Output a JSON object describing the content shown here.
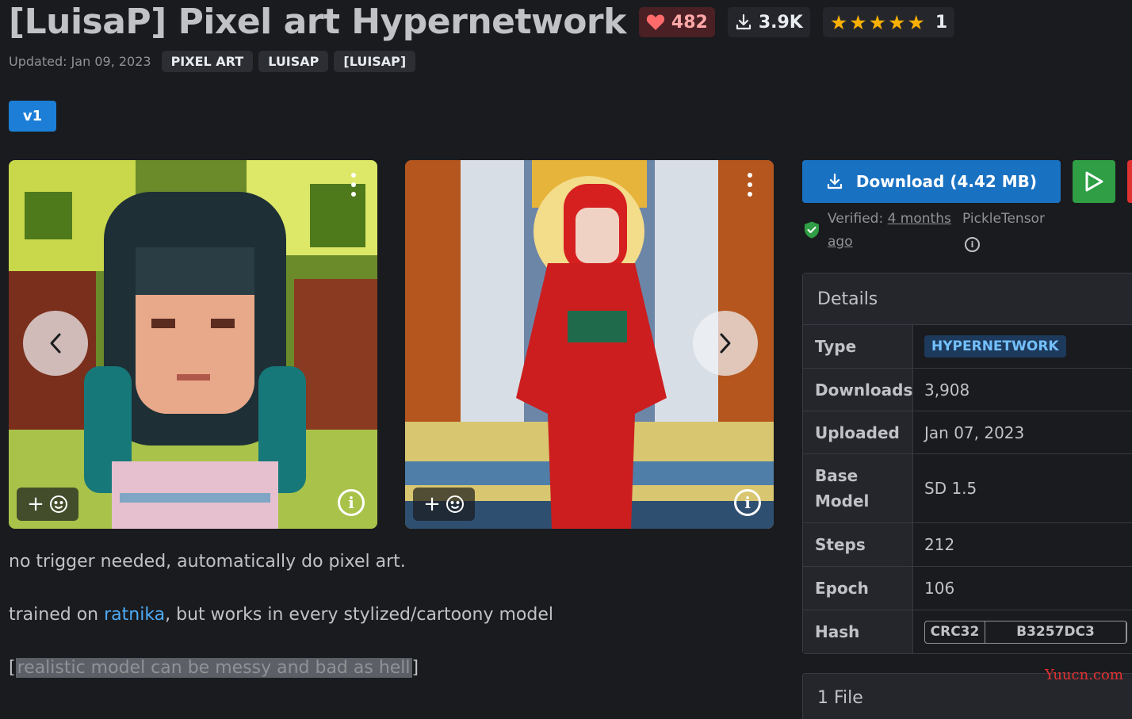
{
  "header": {
    "title": "[LuisaP] Pixel art Hypernetwork",
    "likes": "482",
    "downloads": "3.9K",
    "rating_stars": "★★★★★",
    "rating_count": "1"
  },
  "meta": {
    "updated": "Updated: Jan 09, 2023",
    "tags": [
      "PIXEL ART",
      "LUISAP",
      "[LUISAP]"
    ]
  },
  "version": "v1",
  "description": {
    "line1": "no trigger needed, automatically do pixel art.",
    "line2_before": "trained on ",
    "line2_link": "ratnika",
    "line2_after": ", but works in every stylized/cartoony model",
    "line3_open": "[",
    "line3_highlight": "realistic model can be messy and bad as hell",
    "line3_close": "]"
  },
  "sidebar": {
    "download_label": "Download (4.42 MB)",
    "verified_label": "Verified: ",
    "verified_when": "4 months ago",
    "scanner": "PickleTensor",
    "details_title": "Details",
    "details": [
      {
        "key": "Type",
        "value": "HYPERNETWORK"
      },
      {
        "key": "Downloads",
        "value": "3,908"
      },
      {
        "key": "Uploaded",
        "value": "Jan 07, 2023"
      },
      {
        "key": "Base Model",
        "value": "SD 1.5"
      },
      {
        "key": "Steps",
        "value": "212"
      },
      {
        "key": "Epoch",
        "value": "106"
      },
      {
        "key": "Hash",
        "value": "B3257DC3",
        "hash_type": "CRC32"
      }
    ],
    "files_title": "1 File"
  },
  "watermark": "Yuucn.com",
  "colors": {
    "background": "#1a1b1e",
    "primary": "#1971c2",
    "success": "#2f9e44",
    "heart": "#ff6b6b",
    "star": "#fab005",
    "link": "#4dabf7"
  }
}
